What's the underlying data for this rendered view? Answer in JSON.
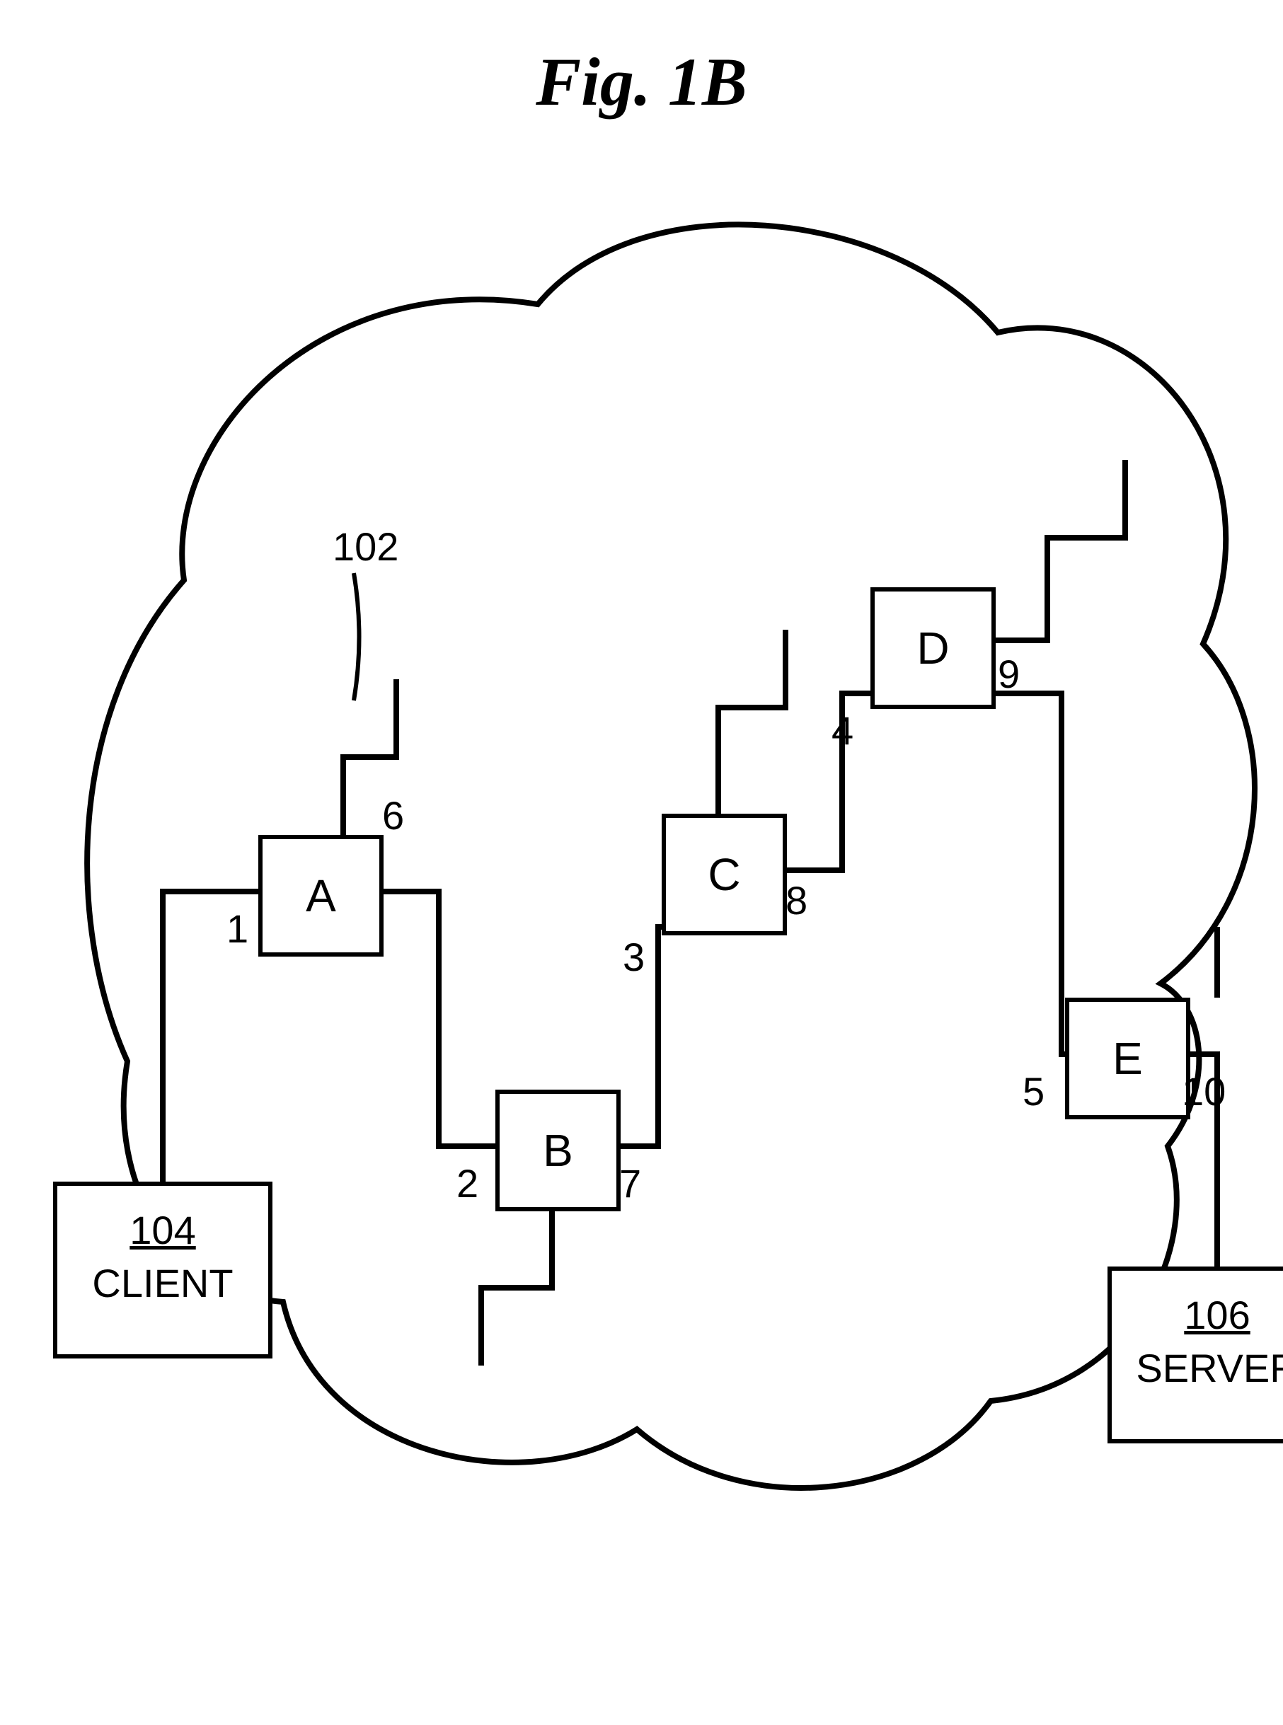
{
  "figure_title": "Fig. 1B",
  "cloud_ref": "102",
  "client": {
    "ref": "104",
    "label": "CLIENT"
  },
  "server": {
    "ref": "106",
    "label": "SERVER"
  },
  "nodes": {
    "A": "A",
    "B": "B",
    "C": "C",
    "D": "D",
    "E": "E"
  },
  "ports": {
    "p1": "1",
    "p2": "2",
    "p3": "3",
    "p4": "4",
    "p5": "5",
    "p6": "6",
    "p7": "7",
    "p8": "8",
    "p9": "9",
    "p10": "10"
  }
}
